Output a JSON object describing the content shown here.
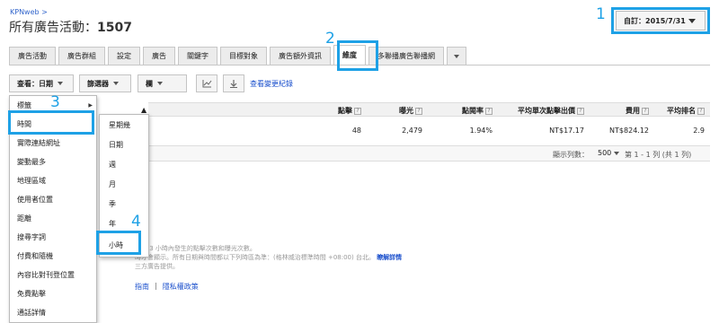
{
  "header": {
    "breadcrumb": "KPNweb >",
    "title_prefix": "所有廣告活動：",
    "title_count": "1507"
  },
  "date_picker": {
    "label": "自訂：2015/7/31"
  },
  "steps": {
    "s1": "1",
    "s2": "2",
    "s3": "3",
    "s4": "4"
  },
  "tabs": [
    {
      "label": "廣告活動"
    },
    {
      "label": "廣告群組"
    },
    {
      "label": "設定"
    },
    {
      "label": "廣告"
    },
    {
      "label": "關鍵字"
    },
    {
      "label": "目標對象"
    },
    {
      "label": "廣告額外資訊"
    },
    {
      "label": "維度"
    },
    {
      "label": "多聯播廣告聯播網"
    }
  ],
  "toolbar": {
    "view_label": "查看：日期",
    "filter_label": "篩選器",
    "columns_label": "欄",
    "change_history_link": "查看變更紀錄"
  },
  "table": {
    "headers": {
      "clicks": "點擊",
      "impressions": "曝光",
      "ctr": "點閱率",
      "avg_cpc": "平均單次點擊出價",
      "cost": "費用",
      "avg_pos": "平均排名"
    },
    "help": "?",
    "row": {
      "clicks": "48",
      "impressions": "2,479",
      "ctr": "1.94%",
      "avg_cpc": "NT$17.17",
      "cost": "NT$824.12",
      "avg_pos": "2.9"
    },
    "footer": {
      "rows_label": "顯示列數：",
      "rows_value": "500",
      "range": "第 1 - 1 列 (共 1 列)"
    }
  },
  "notes": {
    "line1": "括前 3 小時內發生的點擊次數和曝光次數。",
    "line2": "時才會顯示。所有日期與時間都以下列時區為準：(格林威治標準時間 +08:00) 台北。",
    "line2_link": "瞭解詳情",
    "line3": "三方廣告提供。",
    "footer_link1": "指南",
    "footer_sep": "|",
    "footer_link2": "隱私權政策"
  },
  "dropdown": {
    "items": [
      "標籤",
      "時間",
      "實際連結網址",
      "變動最多",
      "地理區域",
      "使用者位置",
      "距離",
      "搜尋字詞",
      "付費和隨機",
      "內容比對刊登位置",
      "免費點擊",
      "通話詳情"
    ]
  },
  "submenu": {
    "items": [
      "星期幾",
      "日期",
      "週",
      "月",
      "季",
      "年",
      "小時"
    ]
  },
  "colors": {
    "highlight": "#1ea1e6",
    "link": "#1a4fcc"
  }
}
